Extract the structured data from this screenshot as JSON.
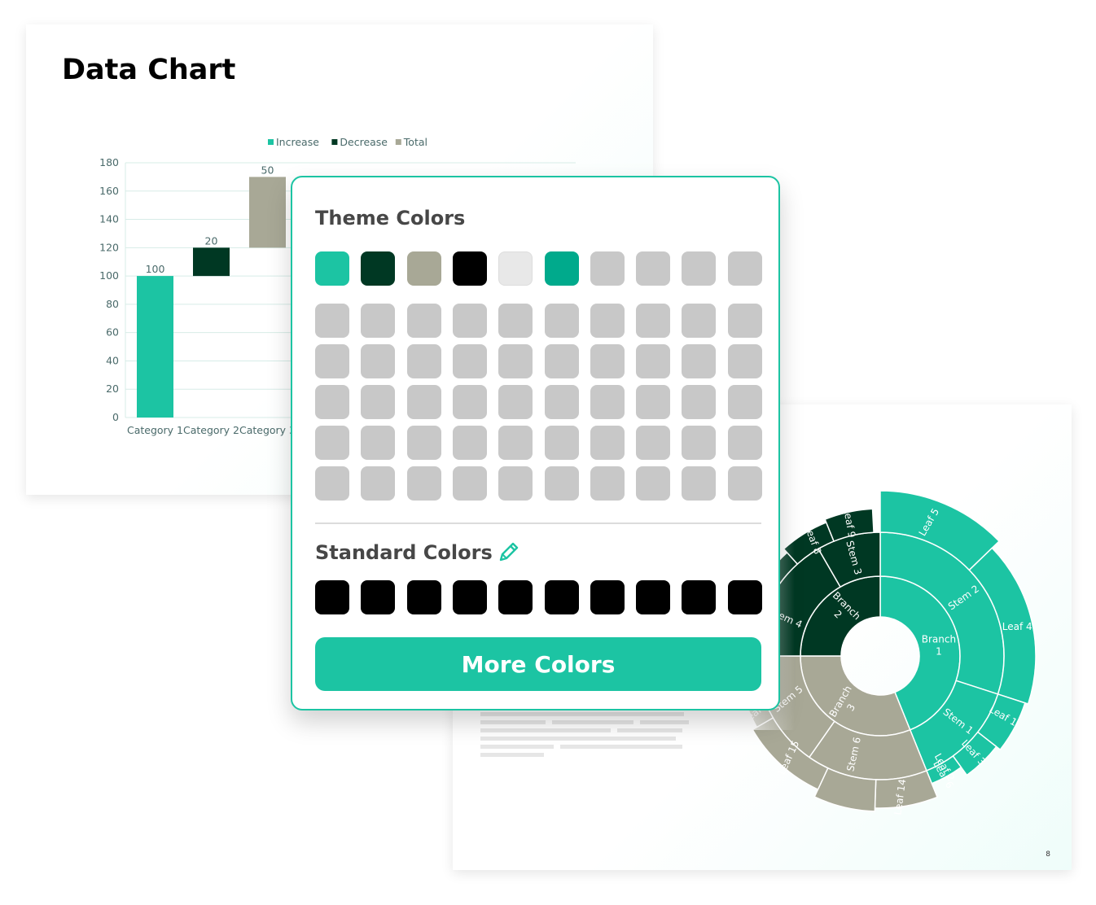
{
  "slide_1": {
    "title": "Data Chart"
  },
  "chart_data": {
    "type": "bar",
    "subtype": "waterfall",
    "legend": [
      "Increase",
      "Decrease",
      "Total"
    ],
    "legend_position": "top",
    "categories": [
      "Category 1",
      "Category 2",
      "Category 3"
    ],
    "values": [
      100,
      20,
      50
    ],
    "bars": [
      {
        "category": "Category 1",
        "kind": "Increase",
        "bottom": 0,
        "top": 100,
        "label": "100"
      },
      {
        "category": "Category 2",
        "kind": "Decrease",
        "bottom": 100,
        "top": 120,
        "label": "20"
      },
      {
        "category": "Category 3",
        "kind": "Total",
        "bottom": 120,
        "top": 170,
        "label": "50"
      }
    ],
    "yticks": [
      "0",
      "20",
      "40",
      "60",
      "80",
      "100",
      "120",
      "140",
      "160",
      "180"
    ],
    "ylim": [
      0,
      180
    ],
    "grid": true,
    "colors": {
      "Increase": "#1cc4a3",
      "Decrease": "#003823",
      "Total": "#a8a896"
    }
  },
  "slide_2": {
    "page_number": "8",
    "sunburst": {
      "branches": [
        {
          "label": "Branch\n1",
          "color": "#1cc4a3"
        },
        {
          "label": "Branch\n2",
          "color": "#003823"
        },
        {
          "label": "Branch\n3",
          "color": "#a8a896"
        }
      ],
      "stems": [
        "Stem 1",
        "Stem 2",
        "Stem 3",
        "Stem 4",
        "Stem 5",
        "Stem 6"
      ],
      "leaves": [
        "Leaf 1",
        "Leaf 2",
        "Leaf 3",
        "Leaf 4",
        "Leaf 5",
        "Leaf 6",
        "Leaf 8",
        "Leaf 9",
        "Leaf 10",
        "Leaf 13",
        "Leaf 14",
        "Leaf 15",
        "af 16"
      ]
    }
  },
  "color_picker": {
    "theme_heading": "Theme Colors",
    "standard_heading": "Standard Colors",
    "more_button": "More Colors",
    "pencil_icon": "pencil-icon",
    "theme_colors": [
      "#1cc4a3",
      "#003823",
      "#a8a896",
      "#000000",
      "#e8e8e8",
      "#00aa8c",
      "#c8c8c8",
      "#c8c8c8",
      "#c8c8c8",
      "#c8c8c8"
    ],
    "shade_rows": 5,
    "shade_color": "#c8c8c8",
    "standard_colors": [
      "#000000",
      "#000000",
      "#000000",
      "#000000",
      "#000000",
      "#000000",
      "#000000",
      "#000000",
      "#000000",
      "#000000"
    ]
  }
}
